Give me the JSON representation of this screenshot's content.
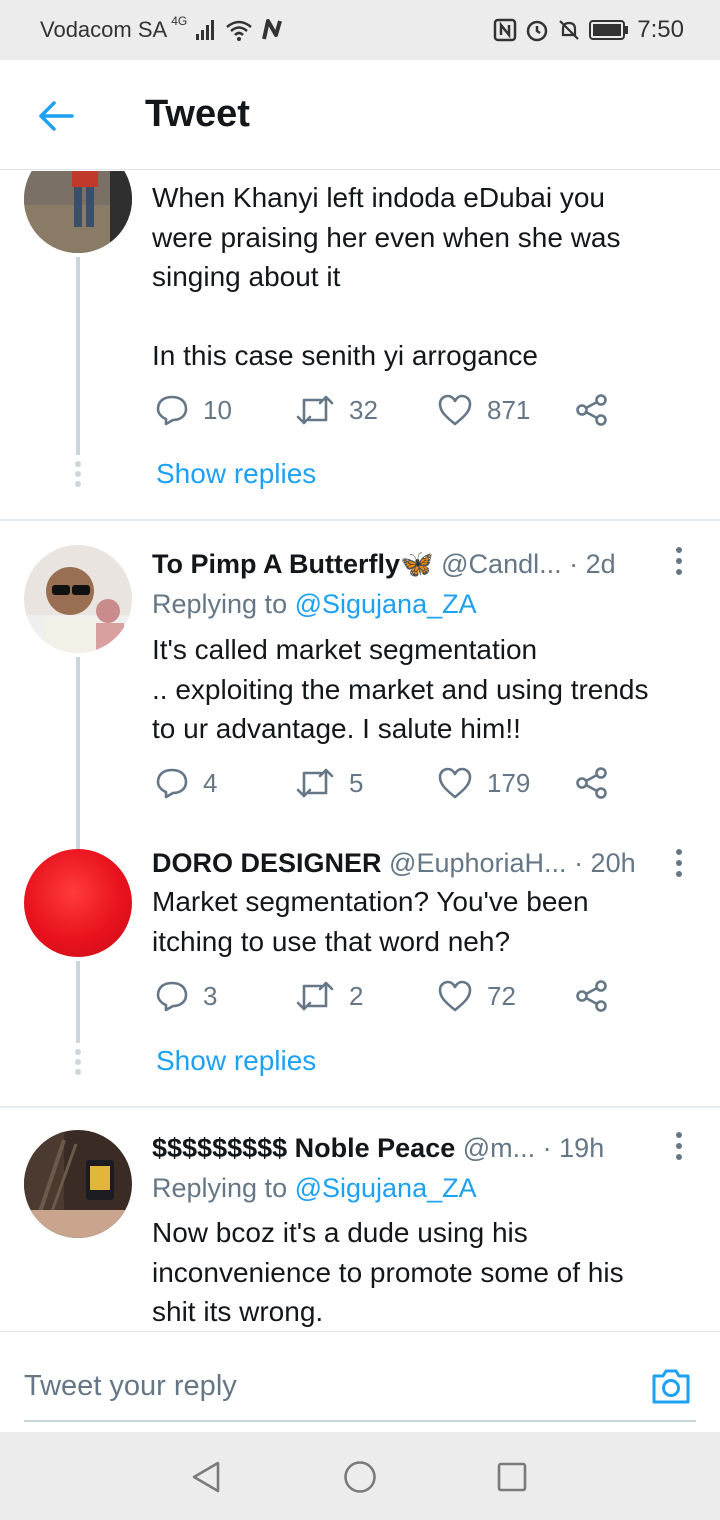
{
  "status_bar": {
    "carrier": "Vodacom SA",
    "network": "4G",
    "time": "7:50",
    "icons": [
      "signal-icon",
      "wifi-icon",
      "n-icon",
      "nfc-icon",
      "alarm-icon",
      "mute-icon",
      "battery-icon"
    ]
  },
  "header": {
    "title": "Tweet",
    "back_icon": "back-arrow-icon"
  },
  "tweets": [
    {
      "text_lines": [
        "When Khanyi left indoda eDubai you",
        "were praising her even when she was",
        "singing about it",
        "",
        "In this case senith yi arrogance"
      ],
      "replies": "10",
      "retweets": "32",
      "likes": "871",
      "show_replies": "Show replies"
    },
    {
      "name": "To Pimp A Butterfly🦋",
      "handle": "@Candl...",
      "time": "· 2d",
      "reply_prefix": "Replying to ",
      "reply_to": "@Sigujana_ZA",
      "text_lines": [
        "It's called market segmentation",
        ".. exploiting the market and using trends",
        "to ur advantage. I salute him!!"
      ],
      "replies": "4",
      "retweets": "5",
      "likes": "179"
    },
    {
      "name": "DORO DESIGNER",
      "handle": "@EuphoriaH...",
      "time": "· 20h",
      "text_lines": [
        "Market segmentation? You've been",
        "itching to use that word neh?"
      ],
      "replies": "3",
      "retweets": "2",
      "likes": "72",
      "show_replies": "Show replies"
    },
    {
      "name": "$$$$$$$$$ Noble Peace",
      "handle": "@m...",
      "time": "· 19h",
      "reply_prefix": "Replying to ",
      "reply_to": "@Sigujana_ZA",
      "text_lines": [
        "Now bcoz it's a dude using his",
        "inconvenience to promote some of his",
        "shit its wrong."
      ]
    }
  ],
  "compose": {
    "placeholder": "Tweet your reply",
    "camera_icon": "camera-icon"
  },
  "nav_bar": {
    "icons": [
      "nav-back-icon",
      "nav-home-icon",
      "nav-recents-icon"
    ]
  },
  "colors": {
    "accent": "#1da1f2",
    "secondary_text": "#657786",
    "thread_line": "#ccd6dd",
    "doro_avatar": "#e8121e"
  }
}
